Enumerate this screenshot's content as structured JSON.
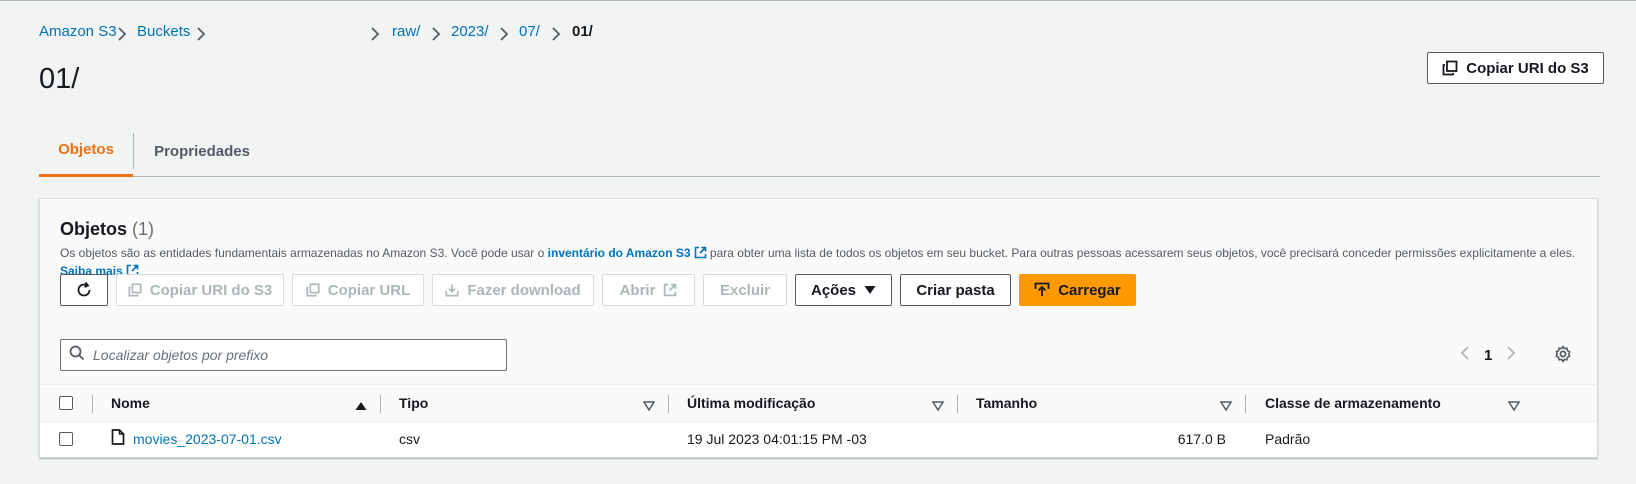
{
  "breadcrumb": {
    "items": [
      "Amazon S3",
      "Buckets",
      "raw/",
      "2023/",
      "07/"
    ],
    "current": "01/"
  },
  "page": {
    "title": "01/"
  },
  "header": {
    "copy_s3_uri": "Copiar URI do S3"
  },
  "tabs": [
    {
      "label": "Objetos",
      "active": true
    },
    {
      "label": "Propriedades",
      "active": false
    }
  ],
  "objects": {
    "title": "Objetos",
    "count": "(1)",
    "desc_pre": "Os objetos são as entidades fundamentais armazenadas no Amazon S3. Você pode usar o ",
    "desc_link": "inventário do Amazon S3",
    "desc_post": " para obter uma lista de todos os objetos em seu bucket. Para outras pessoas acessarem seus objetos, você precisará conceder permissões explicitamente a eles.",
    "learn_more": "Saiba mais"
  },
  "toolbar": {
    "copy_s3_uri": "Copiar URI do S3",
    "copy_url": "Copiar URL",
    "download": "Fazer download",
    "open": "Abrir",
    "delete": "Excluir",
    "actions": "Ações",
    "create_folder": "Criar pasta",
    "upload": "Carregar"
  },
  "search": {
    "placeholder": "Localizar objetos por prefixo",
    "value": ""
  },
  "pagination": {
    "page": "1"
  },
  "table": {
    "columns": [
      "Nome",
      "Tipo",
      "Última modificação",
      "Tamanho",
      "Classe de armazenamento"
    ],
    "rows": [
      {
        "name": "movies_2023-07-01.csv",
        "type": "csv",
        "modified": "19 Jul 2023 04:01:15 PM -03",
        "size": "617.0 B",
        "storage_class": "Padrão"
      }
    ]
  },
  "colors": {
    "accent": "#ec7211",
    "primary_button": "#ff9900",
    "link": "#0073bb"
  }
}
